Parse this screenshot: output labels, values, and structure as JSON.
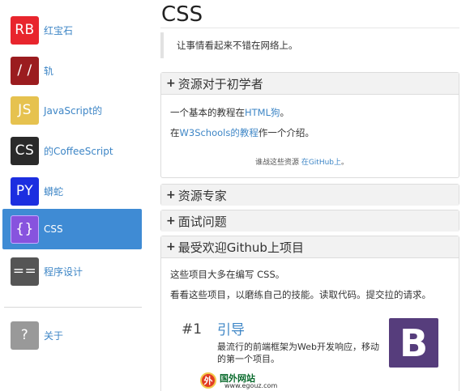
{
  "sidebar": {
    "items": [
      {
        "abbr": "RB",
        "label": "红宝石",
        "color": "#e8252d"
      },
      {
        "abbr": "/ /",
        "label": "轨",
        "color": "#9b1c1f"
      },
      {
        "abbr": "JS",
        "label": "JavaScript的",
        "color": "#e6c24f"
      },
      {
        "abbr": "CS",
        "label": "的CoffeeScript",
        "color": "#2a2a2a"
      },
      {
        "abbr": "PY",
        "label": "蟒蛇",
        "color": "#1c2ee0"
      },
      {
        "abbr": "{}",
        "label": "CSS",
        "color": "#8753de",
        "active": true
      },
      {
        "abbr": "==",
        "label": "程序设计",
        "color": "#555555"
      }
    ],
    "about": {
      "abbr": "?",
      "label": "关于",
      "color": "#999999"
    }
  },
  "main": {
    "title": "CSS",
    "quote": "让事情看起来不错在网络上。",
    "panels": {
      "beginner": {
        "heading": "资源对于初学者",
        "line1_pre": "一个基本的教程在",
        "line1_link": "HTML狗",
        "line1_post": "。",
        "line2_pre": "在",
        "line2_link": "W3Schools的教程",
        "line2_post": "作一个介绍。",
        "note_pre": "谁战这些资源 ",
        "note_link": "在GitHub上",
        "note_post": "。"
      },
      "experts": {
        "heading": "资源专家"
      },
      "interview": {
        "heading": "面试问题"
      },
      "github": {
        "heading": "最受欢迎Github上项目",
        "line1": "这些项目大多在编写 CSS。",
        "line2": "看看这些项目，以磨练自己的技能。读取代码。提交拉的请求。",
        "project": {
          "rank": "#1",
          "name": "引导",
          "desc": "最流行的前端框架为Web开发响应，移动的第一个项目。",
          "logo": "B"
        }
      }
    }
  },
  "watermark": {
    "text": "国外网站",
    "url": "www.egouz.com",
    "badge": "外"
  },
  "colors": {
    "accent": "#3f8bd4",
    "link": "#3e86c6",
    "bootstrap": "#563d7c"
  }
}
